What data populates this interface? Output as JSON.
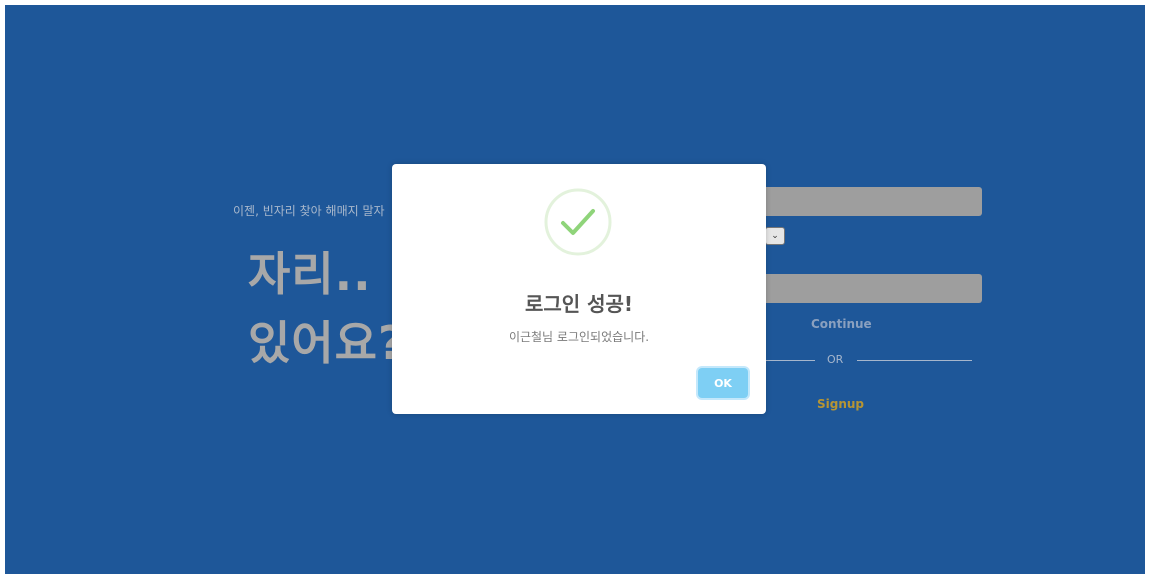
{
  "background": {
    "tagline": "이젠, 빈자리 찾아 해매지 말자",
    "hero_line_1": "자리..",
    "hero_line_2": "있어요?",
    "form": {
      "select_caret": "⌄",
      "continue_label": "Continue",
      "divider_label": "OR",
      "signup_label": "Signup"
    }
  },
  "modal": {
    "icon": "success-check-icon",
    "title": "로그인 성공!",
    "message": "이근철님 로그인되었습니다.",
    "ok_label": "OK"
  },
  "colors": {
    "background": "#1e5799",
    "hero_text": "#a8a8a8",
    "input_bar": "#9e9e9e",
    "signup": "#b69534",
    "ok_button": "#7ecff4",
    "success_check": "#8fd47a",
    "success_ring": "#e3f2dc"
  }
}
